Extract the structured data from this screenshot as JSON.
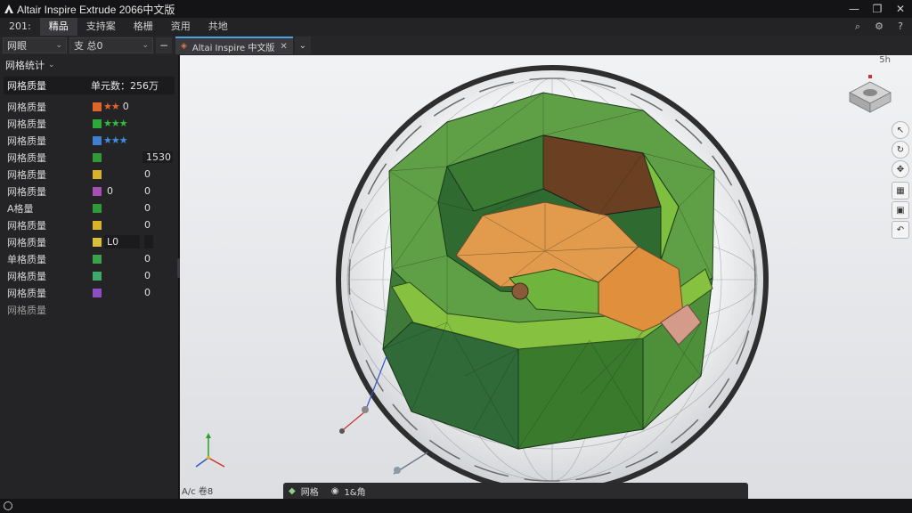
{
  "window": {
    "title": "Altair Inspire Extrude 2066中文版"
  },
  "menu": {
    "items": [
      {
        "label": "201:"
      },
      {
        "label": "精品"
      },
      {
        "label": "支持案"
      },
      {
        "label": "格栅"
      },
      {
        "label": "资用"
      },
      {
        "label": "共地"
      }
    ]
  },
  "toolbar": {
    "dropdown1": "网眼",
    "dropdown2": "支 总0",
    "tab_label": "Altai Inspire 中文版"
  },
  "panel": {
    "header": "网格统计",
    "summary_label": "网格质量",
    "summary_value": "单元数：256万",
    "rows": [
      {
        "label": "网格质量",
        "stars": "★★",
        "star_color": "#e0652a",
        "v1": "0",
        "num": "",
        "swatch": "#e0652a"
      },
      {
        "label": "网格质量",
        "stars": "★★★",
        "star_color": "#2fbf3c",
        "v1": "",
        "num": "",
        "swatch": "#2fa83a"
      },
      {
        "label": "网格质量",
        "stars": "★★★",
        "star_color": "#3f8fe0",
        "v1": "",
        "num": "",
        "swatch": "#3f7fd0"
      },
      {
        "label": "网格质量",
        "stars": "",
        "v1": "",
        "num": "1530",
        "swatch": "#2f9a36"
      },
      {
        "label": "网格质量",
        "stars": "",
        "v1": "",
        "num": "0",
        "swatch": "#d6b32a"
      },
      {
        "label": "网格质量",
        "stars": "",
        "v1": "0",
        "num": "0",
        "swatch": "#a64fb4"
      },
      {
        "label": "A格量",
        "stars": "",
        "v1": "",
        "num": "0",
        "swatch": "#2f9a36"
      },
      {
        "label": "网格质量",
        "stars": "",
        "v1": "",
        "num": "0",
        "swatch": "#d6b32a"
      },
      {
        "label": "网格质量",
        "stars": "",
        "v1": "L0",
        "num": "",
        "swatch": "#d8c23a"
      },
      {
        "label": "单格质量",
        "stars": "",
        "v1": "",
        "num": "0",
        "swatch": "#3aa24a"
      },
      {
        "label": "网格质量",
        "stars": "",
        "v1": "",
        "num": "0",
        "swatch": "#3fa86a"
      },
      {
        "label": "网格质量",
        "stars": "",
        "v1": "",
        "num": "0",
        "swatch": "#8a4fc4"
      }
    ],
    "footer": "网格质量"
  },
  "viewport": {
    "corner_label": "5h",
    "axis_label": "A/c 卷8",
    "status_left": "网格",
    "status_right": "1&角"
  },
  "colors": {
    "accent": "#4aa3df",
    "mesh_green_dark": "#2e7d3a",
    "mesh_green_light": "#7cc143",
    "mesh_orange": "#e09a4a",
    "mesh_brown": "#7a4a2a"
  }
}
